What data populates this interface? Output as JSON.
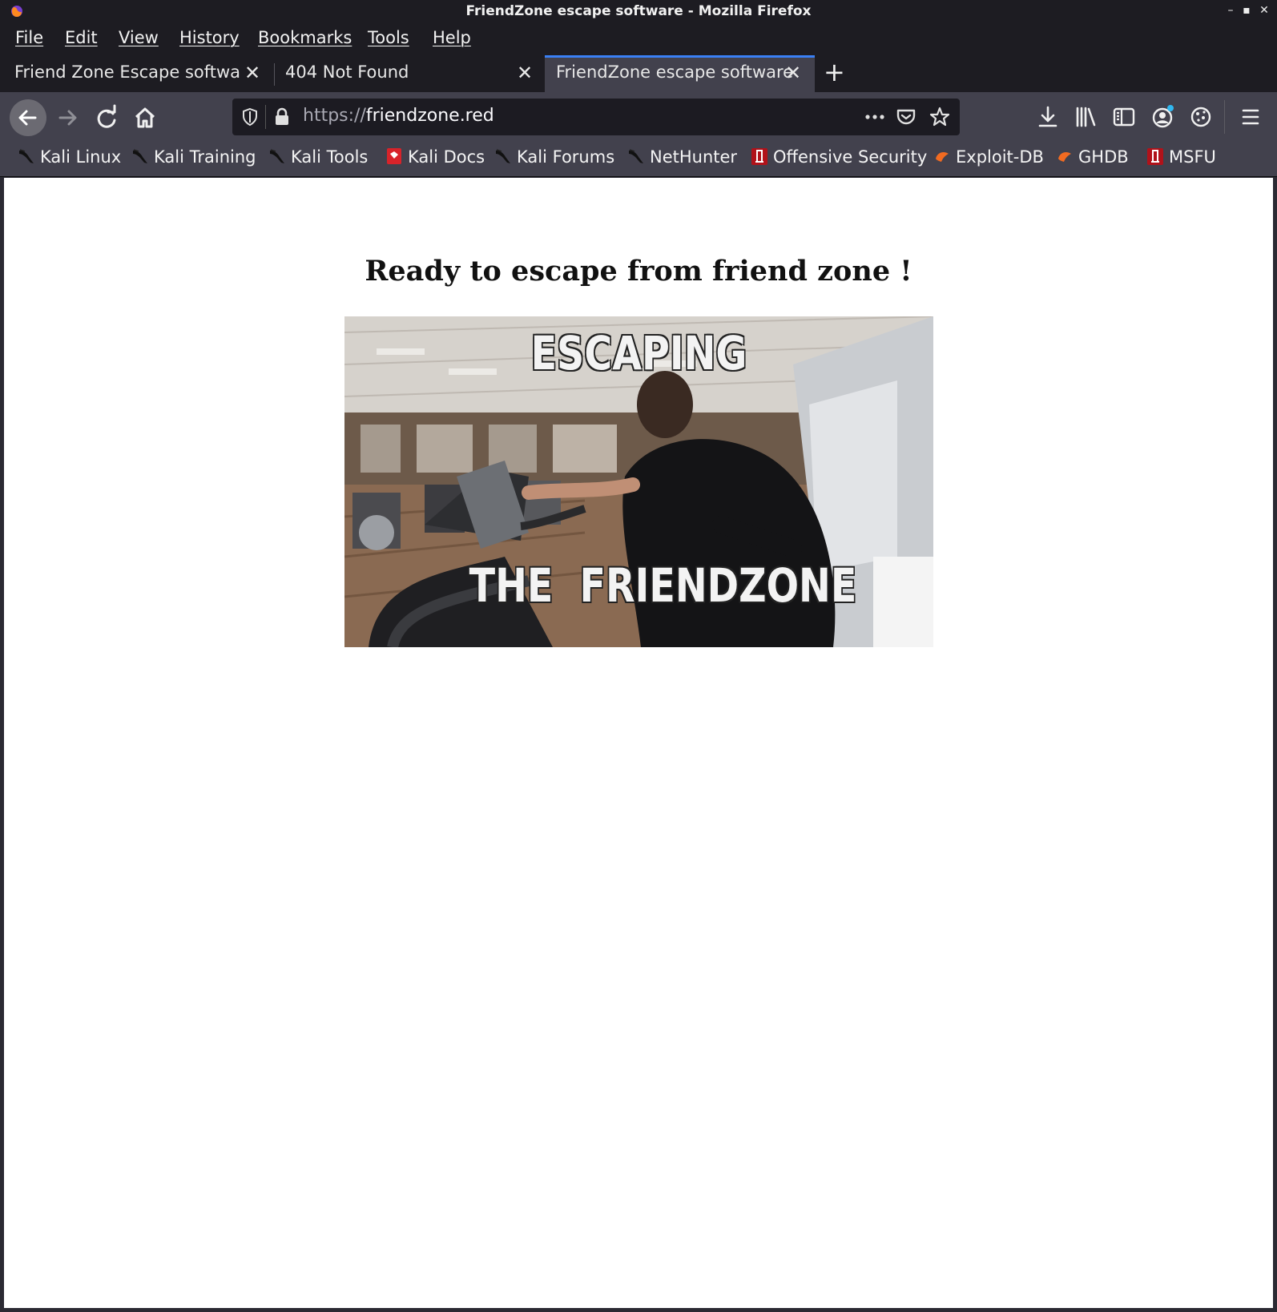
{
  "window": {
    "title": "FriendZone escape software - Mozilla Firefox"
  },
  "menu": [
    "File",
    "Edit",
    "View",
    "History",
    "Bookmarks",
    "Tools",
    "Help"
  ],
  "tabs": [
    {
      "label": "Friend Zone Escape software",
      "active": false
    },
    {
      "label": "404 Not Found",
      "active": false
    },
    {
      "label": "FriendZone escape software",
      "active": true
    }
  ],
  "urlbar": {
    "scheme": "https://",
    "host": "friendzone.red"
  },
  "bookmarks": [
    {
      "label": "Kali Linux",
      "icon": "kali-dragon-icon"
    },
    {
      "label": "Kali Training",
      "icon": "kali-dragon-icon"
    },
    {
      "label": "Kali Tools",
      "icon": "kali-dragon-icon"
    },
    {
      "label": "Kali Docs",
      "icon": "kali-docs-icon"
    },
    {
      "label": "Kali Forums",
      "icon": "kali-dragon-icon"
    },
    {
      "label": "NetHunter",
      "icon": "kali-dragon-icon"
    },
    {
      "label": "Offensive Security",
      "icon": "offsec-icon"
    },
    {
      "label": "Exploit-DB",
      "icon": "exploitdb-icon"
    },
    {
      "label": "GHDB",
      "icon": "exploitdb-icon"
    },
    {
      "label": "MSFU",
      "icon": "offsec-icon"
    }
  ],
  "page": {
    "heading": "Ready to escape from friend zone !",
    "gif_top_text": "ESCAPING",
    "gif_bottom_text": "THE  FRIENDZONE"
  },
  "colors": {
    "active_tab_accent": "#3a80f5",
    "toolbar": "#42414d",
    "chrome_dark": "#1d1c22"
  }
}
